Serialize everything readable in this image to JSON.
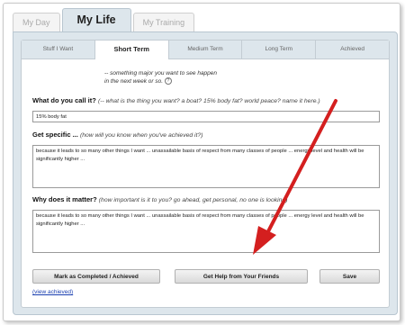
{
  "top_tabs": [
    {
      "label": "My Day"
    },
    {
      "label": "My Life"
    },
    {
      "label": "My Training"
    }
  ],
  "sub_tabs": [
    {
      "label": "Stuff I Want"
    },
    {
      "label": "Short Term"
    },
    {
      "label": "Medium Term"
    },
    {
      "label": "Long Term"
    },
    {
      "label": "Achieved"
    }
  ],
  "intro": {
    "line1": "-- something major you want to see happen",
    "line2": "in the next week or so.",
    "help_icon": "?"
  },
  "q1": {
    "label": "What do you call it?",
    "hint": "(-- what is the thing you want? a boat? 15% body fat? world peace? name it here.)",
    "value": "15% body fat"
  },
  "q2": {
    "label": "Get specific ...",
    "hint": "(how will you know when you've achieved it?)",
    "value": "because it leads to so many other things I want ... unassailable basis of respect from many classes of people ... energy level and health will be significantly higher ..."
  },
  "q3": {
    "label": "Why does it matter?",
    "hint": "(how important is it to you?  go ahead, get personal, no one is looking)",
    "value": "because it leads to so many other things I want ... unassailable basis of respect from many classes of people ... energy level and health will be significantly higher ..."
  },
  "buttons": {
    "mark_completed": "Mark as Completed / Achieved",
    "get_help": "Get Help from Your Friends",
    "save": "Save"
  },
  "view_achieved_link": "(view achieved)",
  "colors": {
    "arrow": "#d41f1f",
    "panel": "#dde6ec",
    "link": "#1a3fb0"
  }
}
